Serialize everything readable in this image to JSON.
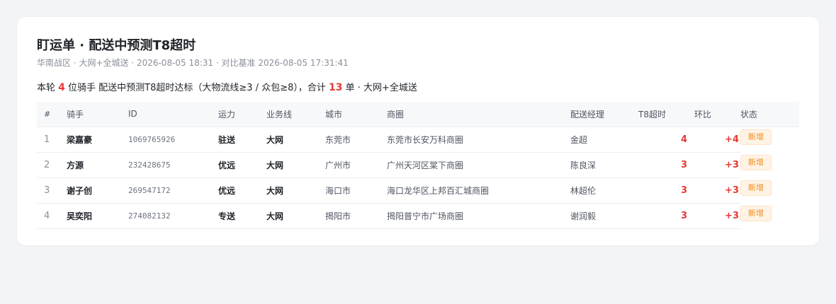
{
  "header": {
    "title": "盯运单 · 配送中预测T8超时",
    "subtitle": "华南战区 · 大网+全城送 · 2026-08-05 18:31 · 对比基准 2026-08-05 17:31:41"
  },
  "summary": {
    "prefix": "本轮",
    "rider_count": "4",
    "middle": "位骑手 配送中预测T8超时达标（大物流线≥3 / 众包≥8），合计",
    "order_count": "13",
    "suffix": "单 · 大网+全城送"
  },
  "table": {
    "headers": {
      "idx": "#",
      "rider": "骑手",
      "id": "ID",
      "capacity": "运力",
      "business": "业务线",
      "city": "城市",
      "area": "商圈",
      "manager": "配送经理",
      "t8": "T8超时",
      "delta": "环比",
      "status": "状态"
    },
    "rows": [
      {
        "idx": "1",
        "rider": "梁嘉豪",
        "id": "1069765926",
        "capacity": "驻送",
        "business": "大网",
        "city": "东莞市",
        "area": "东莞市长安万科商圈",
        "manager": "金超",
        "t8": "4",
        "delta": "+4",
        "status": "新增"
      },
      {
        "idx": "2",
        "rider": "方源",
        "id": "232428675",
        "capacity": "优远",
        "business": "大网",
        "city": "广州市",
        "area": "广州天河区棠下商圈",
        "manager": "陈良深",
        "t8": "3",
        "delta": "+3",
        "status": "新增"
      },
      {
        "idx": "3",
        "rider": "谢子创",
        "id": "269547172",
        "capacity": "优远",
        "business": "大网",
        "city": "海口市",
        "area": "海口龙华区上邦百汇城商圈",
        "manager": "林超伦",
        "t8": "3",
        "delta": "+3",
        "status": "新增"
      },
      {
        "idx": "4",
        "rider": "吴奕阳",
        "id": "274082132",
        "capacity": "专送",
        "business": "大网",
        "city": "揭阳市",
        "area": "揭阳普宁市广场商圈",
        "manager": "谢润毅",
        "t8": "3",
        "delta": "+3",
        "status": "新增"
      }
    ]
  },
  "colors": {
    "accent_red": "#e53935",
    "badge_orange": "#f08c1c",
    "badge_bg": "#fff3e6"
  }
}
